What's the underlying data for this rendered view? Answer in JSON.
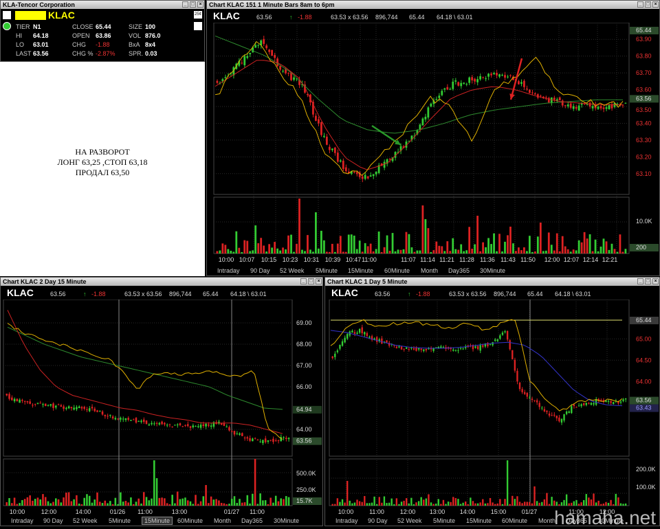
{
  "quote": {
    "title": "KLA-Tencor Corporation",
    "symbol": "KLAC",
    "badge": "25¢",
    "rows": [
      {
        "l1": "TIER",
        "v1": "N1",
        "l2": "CLOSE",
        "v2": "65.44",
        "l3": "SIZE",
        "v3": "100"
      },
      {
        "l1": "HI",
        "v1": "64.18",
        "l2": "OPEN",
        "v2": "63.86",
        "l3": "VOL",
        "v3": "876.0"
      },
      {
        "l1": "LO",
        "v1": "63.01",
        "l2": "CHG",
        "v2": "-1.88",
        "l3": "BxA",
        "v3": "8x4"
      },
      {
        "l1": "LAST",
        "v1": "63.56",
        "l2": "CHG %",
        "v2": "-2.87%",
        "l3": "SPR.",
        "v3": "0.03"
      }
    ]
  },
  "note": {
    "line1": "НА РАЗВОРОТ",
    "line2": "ЛОНГ 63,25 ,СТОП 63,18",
    "line3": "ПРОДАЛ 63,50"
  },
  "common_header": {
    "symbol": "KLAC",
    "last": "63.56",
    "arrow": "↑",
    "chg": "-1.88",
    "bidask": "63.53 x 63.56",
    "volume": "896,744",
    "close": "65.44",
    "hilo": "64.18 \\ 63.01"
  },
  "chart_main": {
    "title": "Chart KLAC 151 1 Minute Bars 8am to 6pm",
    "price_labels": [
      "65.44",
      "63.90",
      "63.80",
      "63.70",
      "63.60",
      "63.56",
      "63.50",
      "63.40",
      "63.30",
      "63.20",
      "63.10"
    ],
    "vol_labels": [
      "10.0K",
      "200"
    ],
    "time_labels": [
      "10:00",
      "10:07",
      "10:15",
      "10:23",
      "10:31",
      "10:39",
      "10:47",
      "11:00",
      "11:07",
      "11:14",
      "11:21",
      "11:28",
      "11:36",
      "11:43",
      "11:50",
      "12:00",
      "12:07",
      "12:14",
      "12:21"
    ],
    "tabs": [
      "Intraday",
      "90 Day",
      "52 Week",
      "5Minute",
      "15Minute",
      "60Minute",
      "Month",
      "Day365",
      "30Minute"
    ]
  },
  "chart_left": {
    "title": "Chart KLAC 2 Day 15 Minute",
    "price_labels": [
      "69.00",
      "68.00",
      "67.00",
      "66.00",
      "64.94",
      "64.00",
      "63.56"
    ],
    "vol_labels": [
      "500.0K",
      "250.0K",
      "15.7K"
    ],
    "time_labels": [
      "10:00",
      "12:00",
      "14:00",
      "01/26",
      "11:00",
      "13:00",
      "01/27",
      "11:00"
    ],
    "tabs": [
      "Intraday",
      "90 Day",
      "52 Week",
      "5Minute",
      "15Minute",
      "60Minute",
      "Month",
      "Day365",
      "30Minute"
    ],
    "selected_tab": "15Minute"
  },
  "chart_right": {
    "title": "Chart KLAC 1 Day 5 Minute",
    "price_labels": [
      "65.44",
      "65.00",
      "64.50",
      "64.00",
      "63.56",
      "63.43"
    ],
    "vol_labels": [
      "200.0K",
      "100.0K"
    ],
    "time_labels": [
      "10:00",
      "11:00",
      "12:00",
      "13:00",
      "14:00",
      "15:00",
      "01/27",
      "11:00",
      "12:00"
    ],
    "tabs": [
      "Intraday",
      "90 Day",
      "52 Week",
      "5Minute",
      "15Minute",
      "60Minute",
      "Month",
      "Day365",
      "30Minute"
    ]
  },
  "watermark": "hamaha.net",
  "colors": {
    "up": "#33cc33",
    "down": "#dd2222",
    "ma_red": "#cc2222",
    "ma_green": "#2e8b2e",
    "vwap": "#e0b000",
    "blue": "#3333cc",
    "symbol_bg": "#ffff00",
    "up_color": "#33cc33"
  }
}
